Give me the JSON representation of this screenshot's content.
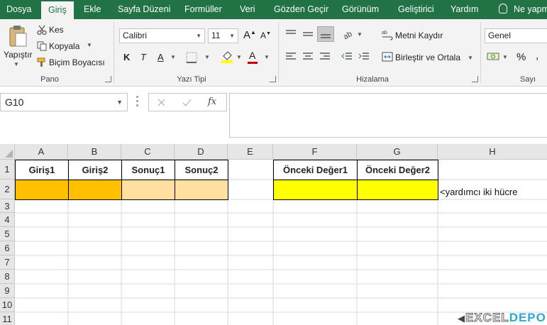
{
  "menu": {
    "tabs": [
      "Dosya",
      "Giriş",
      "Ekle",
      "Sayfa Düzeni",
      "Formüller",
      "Veri",
      "Gözden Geçir",
      "Görünüm",
      "Geliştirici",
      "Yardım"
    ],
    "tell_me": "Ne yapm"
  },
  "ribbon": {
    "clipboard": {
      "paste": "Yapıştır",
      "cut": "Kes",
      "copy": "Kopyala",
      "format_painter": "Biçim Boyacısı",
      "label": "Pano"
    },
    "font": {
      "name": "Calibri",
      "size": "11",
      "bold": "K",
      "italic": "T",
      "underline": "A",
      "label": "Yazı Tipi",
      "fill_color": "#ffff00",
      "font_color": "#c00000"
    },
    "alignment": {
      "wrap": "Metni Kaydır",
      "merge": "Birleştir ve Ortala",
      "label": "Hizalama"
    },
    "number": {
      "format": "Genel",
      "label": "Sayı"
    }
  },
  "formula_bar": {
    "name_box": "G10",
    "fx": "fx",
    "content": ""
  },
  "sheet": {
    "columns": [
      "A",
      "B",
      "C",
      "D",
      "E",
      "F",
      "G",
      "H"
    ],
    "rows": [
      "1",
      "2",
      "3",
      "4",
      "5",
      "6",
      "7",
      "8",
      "9",
      "10",
      "11"
    ],
    "headers": {
      "A1": "Giriş1",
      "B1": "Giriş2",
      "C1": "Sonuç1",
      "D1": "Sonuç2",
      "F1": "Önceki Değer1",
      "G1": "Önceki Değer2"
    },
    "note_H2": "<yardımcı iki hücre",
    "colors": {
      "input": "#ffc000",
      "result": "#ffe0a0",
      "helper": "#ffff00",
      "ribbon_green": "#217346"
    }
  },
  "watermark": {
    "part1": "EXCEL",
    "part2": "DEPO"
  }
}
